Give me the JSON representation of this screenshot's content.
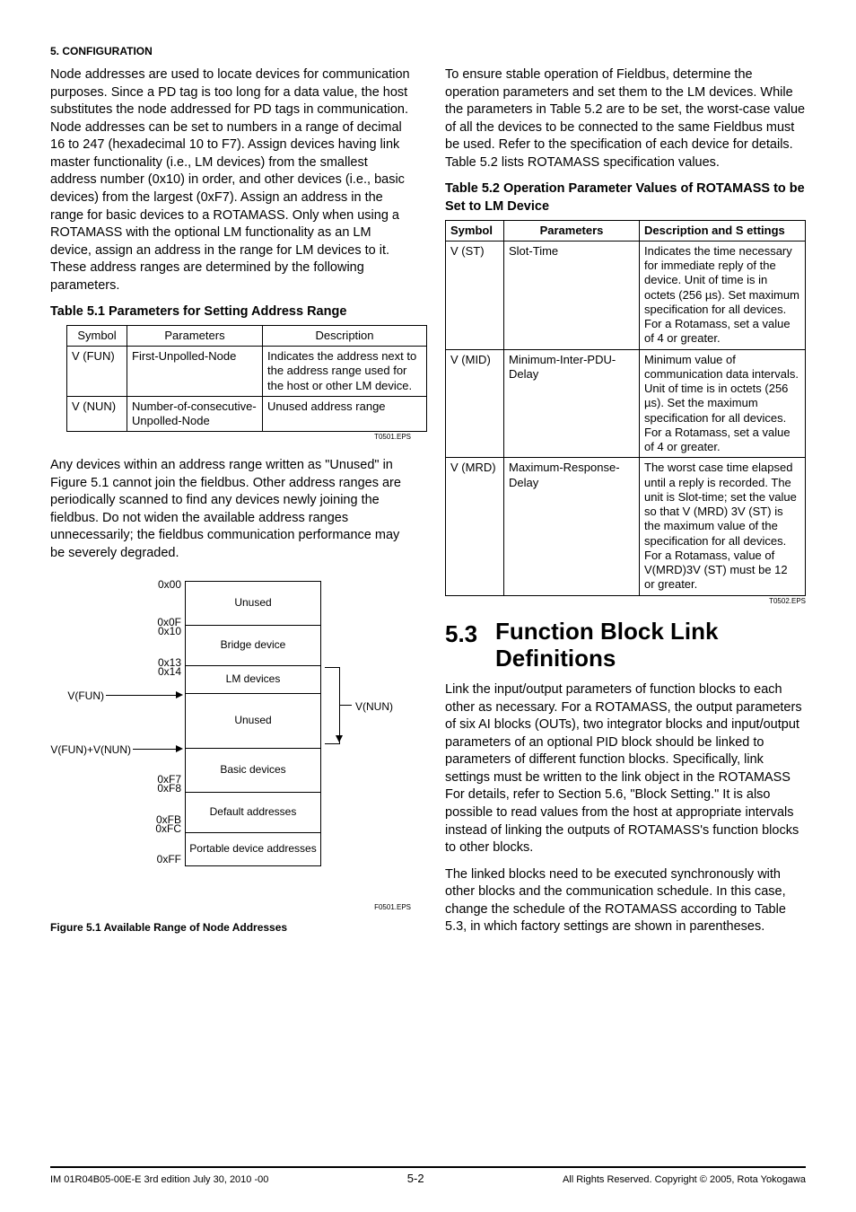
{
  "header": {
    "section": "5.  CONFIGURATION"
  },
  "left": {
    "p1": "Node addresses are used to locate devices for communication purposes.  Since a PD tag is too long for a data value, the host substitutes the node addressed for PD tags in communication.  Node addresses can be set to numbers in a range of decimal 16 to 247 (hexadecimal 10 to F7).  Assign devices having link master functionality (i.e., LM devices) from the smallest address number (0x10) in order, and other devices (i.e., basic devices) from the largest (0xF7).  Assign an address in the range for basic devices to a ROTAMASS.  Only when using a ROTAMASS with the optional LM functionality as an LM device, assign an address in the range for LM devices to it.  These address ranges are determined by the following parameters.",
    "table51_title": "Table 5.1 Parameters for Setting Address Range",
    "table51": {
      "headers": [
        "Symbol",
        "Parameters",
        "Description"
      ],
      "rows": [
        {
          "c0": "V (FUN)",
          "c1": "First-Unpolled-Node",
          "c2": "Indicates the address next to the address range used for the host or other LM device."
        },
        {
          "c0": "V (NUN)",
          "c1": "Number-of-consecutive-Unpolled-Node",
          "c2": "Unused address range"
        }
      ],
      "eps": "T0501.EPS"
    },
    "p2": "Any devices within an address range written as \"Unused\" in Figure 5.1 cannot join the fieldbus.  Other address ranges are periodically scanned to find any devices newly joining the fieldbus.  Do not widen the available address ranges unnecessarily; the fieldbus communication performance may be severely degraded.",
    "figure51": {
      "boxes": [
        "Unused",
        "Bridge device",
        "LM devices",
        "Unused",
        "Basic devices",
        "Default addresses",
        "Portable device addresses"
      ],
      "addr": {
        "a0": "0x00",
        "a1a": "0x0F",
        "a1b": "0x10",
        "a2a": "0x13",
        "a2b": "0x14",
        "a4a": "0xF7",
        "a4b": "0xF8",
        "a5a": "0xFB",
        "a5b": "0xFC",
        "a6": "0xFF"
      },
      "vfun": "V(FUN)",
      "vfun_vnun": "V(FUN)+V(NUN)",
      "vnun": "V(NUN)",
      "eps": "F0501.EPS",
      "caption": "Figure 5.1    Available Range of Node Addresses"
    }
  },
  "right": {
    "p1": "To ensure stable operation of Fieldbus, determine the operation parameters and set them to the LM devices. While the parameters in Table 5.2 are to be set, the worst-case value of all the devices to be connected to the same Fieldbus must be used. Refer to the specification of each device for details. Table 5.2 lists ROTAMASS specification values.",
    "table52_title": "Table 5.2 Operation Parameter Values of ROTAMASS to be Set to LM Device",
    "table52": {
      "headers": [
        "Symbol",
        "Parameters",
        "Description  and S ettings"
      ],
      "rows": [
        {
          "c0": "V (ST)",
          "c1": "Slot-Time",
          "c2": "Indicates the time necessary for immediate reply of the device. Unit of time is in octets (256 µs). Set maximum specification for all devices. For a Rotamass, set a value of 4 or greater."
        },
        {
          "c0": "V (MID)",
          "c1": "Minimum-Inter-PDU-Delay",
          "c2": "Minimum value of communication data intervals. Unit of time is in octets (256 µs). Set the maximum specification for all devices. For a Rotamass, set a value of 4 or greater."
        },
        {
          "c0": "V (MRD)",
          "c1": "Maximum-Response-Delay",
          "c2": "The worst case time elapsed until a reply is recorded. The unit is Slot-time; set the value so that V (MRD) 3V (ST) is the maximum value of the specification for all devices. For a Rotamass, value of V(MRD)3V (ST) must be 12 or greater."
        }
      ],
      "eps": "T0502.EPS"
    },
    "h2_num": "5.3",
    "h2_text": "Function Block Link Definitions",
    "p2": "Link the input/output parameters of function blocks to each other as necessary.  For a ROTAMASS, the output parameters of six AI blocks (OUTs), two integrator blocks and input/output parameters of an optional PID block should be linked to parameters of different function blocks.  Specifically, link settings must be written to the link object in the ROTAMASS  For details, refer to Section 5.6, \"Block Setting.\"  It is also possible to read values from the host at appropriate intervals instead of linking the outputs of ROTAMASS's function blocks to other blocks.",
    "p3": "The linked blocks need to be executed synchronously with other blocks and the communication schedule.  In this case, change the schedule of the ROTAMASS according to Table 5.3, in which factory settings are shown in parentheses."
  },
  "footer": {
    "left": "IM 01R04B05-00E-E    3rd edition July 30, 2010 -00",
    "center": "5-2",
    "right": "All Rights Reserved. Copyright © 2005, Rota Yokogawa"
  }
}
